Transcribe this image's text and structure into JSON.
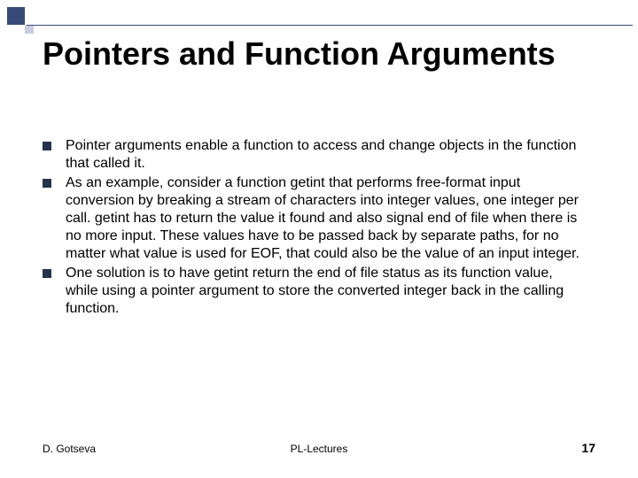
{
  "title": "Pointers and Function Arguments",
  "bullets": [
    "Pointer arguments enable a function to access and change objects in the function that called it.",
    "As an example, consider a function getint that performs free-format input conversion by breaking a stream of characters into integer values, one integer per call. getint has to return the value it found and also signal end of file when there is no more input. These values have to be passed back by separate paths, for no matter what value is used for EOF, that could also be the value of an input integer.",
    "One solution is to have getint return the end of file status as its function value, while using a pointer argument to store the converted integer back in the calling function."
  ],
  "footer": {
    "author": "D. Gotseva",
    "center": "PL-Lectures",
    "page": "17"
  }
}
